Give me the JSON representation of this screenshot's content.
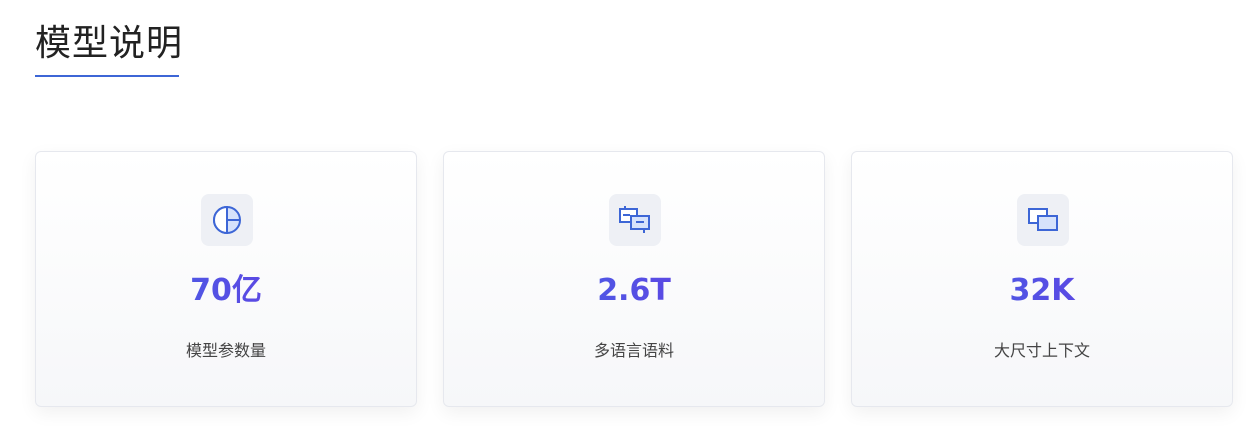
{
  "section": {
    "title": "模型说明",
    "accent_color": "#3d66d6"
  },
  "cards": [
    {
      "icon": "pie-chart-icon",
      "value": "70亿",
      "label": "模型参数量"
    },
    {
      "icon": "translate-icon",
      "value": "2.6T",
      "label": "多语言语料"
    },
    {
      "icon": "context-window-icon",
      "value": "32K",
      "label": "大尺寸上下文"
    }
  ],
  "colors": {
    "value_gradient_start": "#3a6fe8",
    "value_gradient_end": "#7030e0",
    "icon_stroke": "#3d66d6",
    "icon_fill": "#d6e2fb",
    "icon_background": "#eef0f5"
  }
}
